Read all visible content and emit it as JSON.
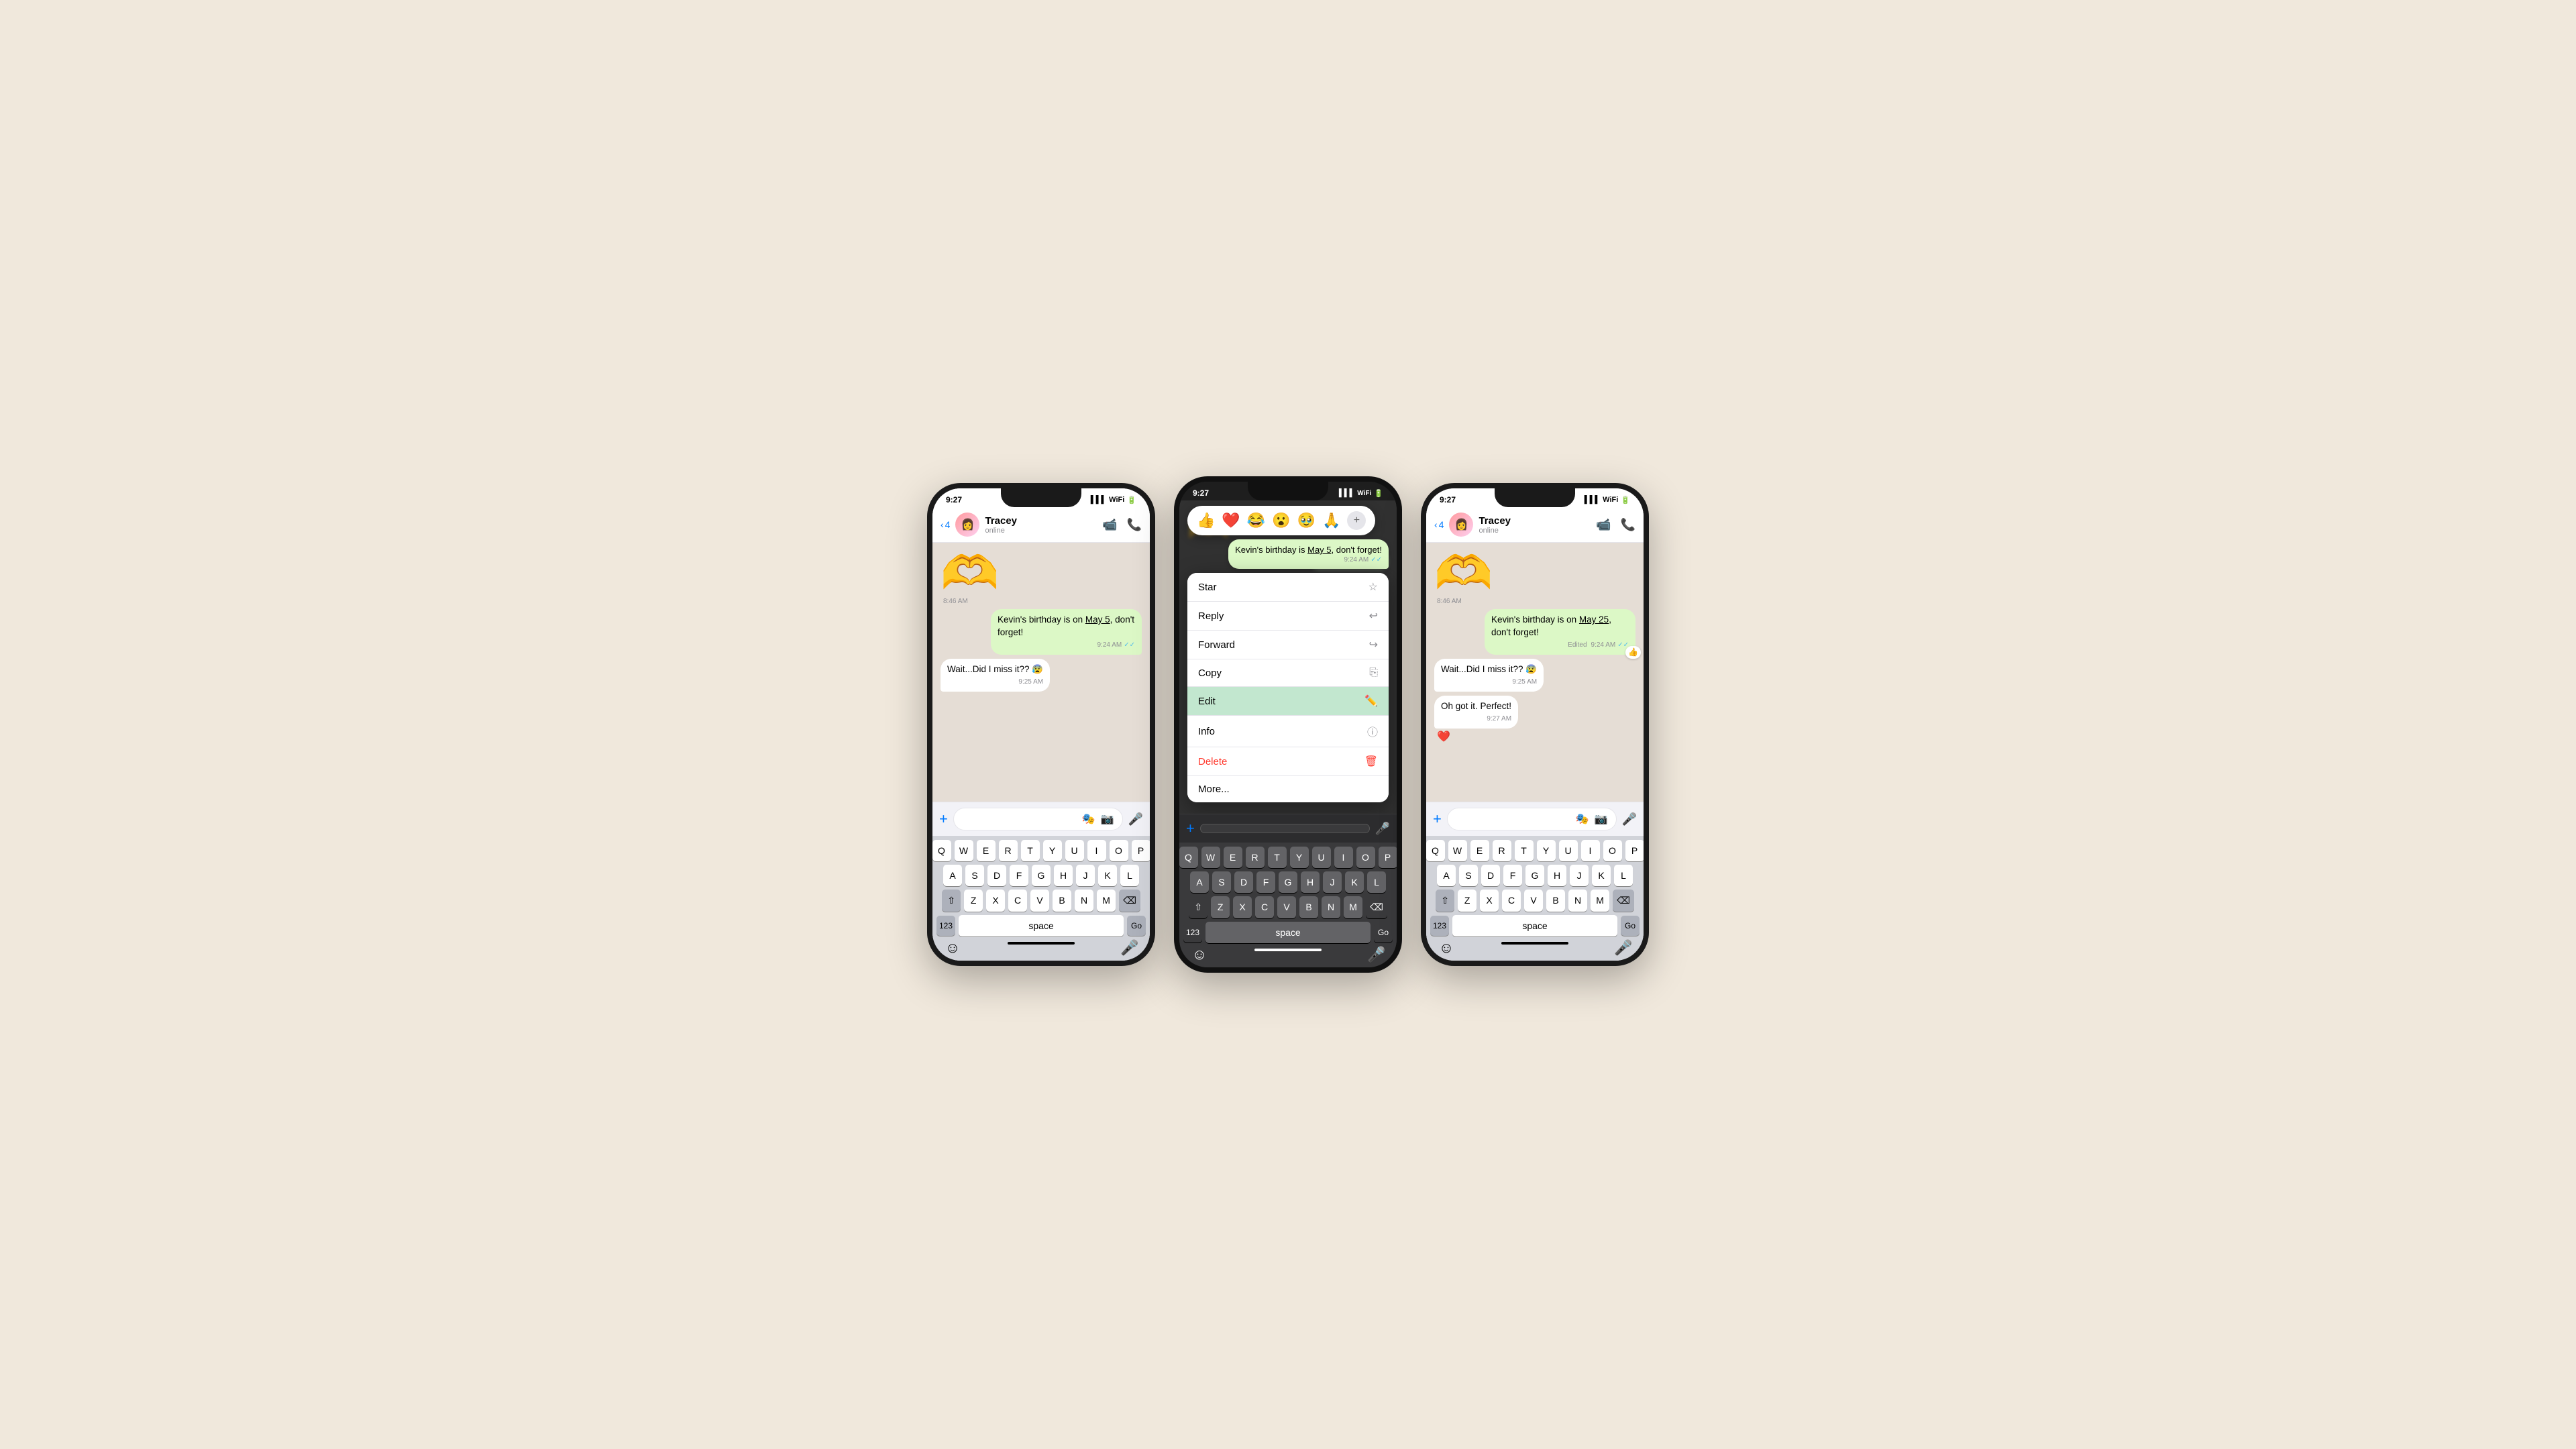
{
  "background": "#f0e8dc",
  "phones": [
    {
      "id": "phone-left",
      "status_time": "9:27",
      "contact_name": "Tracey",
      "contact_status": "online",
      "back_count": "4",
      "messages": [
        {
          "type": "sticker",
          "side": "received",
          "emoji": "🫶",
          "sticker_emoji": "💗",
          "time": "8:46 AM"
        },
        {
          "type": "text",
          "side": "sent",
          "text": "Kevin's birthday is  on May 5, don't forget!",
          "time": "9:24 AM",
          "ticks": "✓✓",
          "underline": "May 5"
        },
        {
          "type": "text",
          "side": "received",
          "text": "Wait...Did I miss it?? 😰",
          "time": "9:25 AM"
        }
      ]
    },
    {
      "id": "phone-middle",
      "status_time": "9:27",
      "blurred_msgs": [
        {
          "side": "received",
          "text": "blurred content"
        },
        {
          "side": "sent",
          "text": "blurred sent"
        }
      ],
      "highlighted_msg": {
        "text": "Kevin's birthday is  May 5, don't forget!",
        "time": "9:24 AM",
        "ticks": "✓✓",
        "underline": "May 5"
      },
      "emoji_reactions": [
        "👍",
        "❤️",
        "😂",
        "😮",
        "🥹",
        "🙏"
      ],
      "context_items": [
        {
          "label": "Star",
          "icon": "☆",
          "highlighted": false
        },
        {
          "label": "Reply",
          "icon": "↩",
          "highlighted": false
        },
        {
          "label": "Forward",
          "icon": "↪",
          "highlighted": false
        },
        {
          "label": "Copy",
          "icon": "⎘",
          "highlighted": false
        },
        {
          "label": "Edit",
          "icon": "✏️",
          "highlighted": true
        },
        {
          "label": "Info",
          "icon": "ⓘ",
          "highlighted": false
        },
        {
          "label": "Delete",
          "icon": "🗑",
          "highlighted": false,
          "delete": true
        },
        {
          "label": "More...",
          "icon": "",
          "highlighted": false
        }
      ]
    },
    {
      "id": "phone-right",
      "status_time": "9:27",
      "contact_name": "Tracey",
      "contact_status": "online",
      "back_count": "4",
      "messages": [
        {
          "type": "sticker",
          "side": "received",
          "time": "8:46 AM"
        },
        {
          "type": "text",
          "side": "sent",
          "text": "Kevin's birthday is  on May 25, don't forget!",
          "time": "Edited 9:24 AM",
          "ticks": "✓✓",
          "underline": "May 25",
          "edited": true,
          "reaction": "👍"
        },
        {
          "type": "text",
          "side": "received",
          "text": "Wait...Did I miss it?? 😰",
          "time": "9:25 AM"
        },
        {
          "type": "text",
          "side": "received",
          "text": "Oh got it. Perfect!",
          "time": "9:27 AM",
          "heart": "❤️"
        }
      ]
    }
  ],
  "keyboard": {
    "row1": [
      "Q",
      "W",
      "E",
      "R",
      "T",
      "Y",
      "U",
      "I",
      "O",
      "P"
    ],
    "row2": [
      "A",
      "S",
      "D",
      "F",
      "G",
      "H",
      "J",
      "K",
      "L"
    ],
    "row3_mid": [
      "Z",
      "X",
      "C",
      "V",
      "B",
      "N",
      "M"
    ],
    "fn_123": "123",
    "space": "space",
    "go": "Go"
  },
  "context_menu": {
    "star_label": "Star",
    "reply_label": "Reply",
    "forward_label": "Forward",
    "copy_label": "Copy",
    "edit_label": "Edit",
    "info_label": "Info",
    "delete_label": "Delete",
    "more_label": "More..."
  }
}
